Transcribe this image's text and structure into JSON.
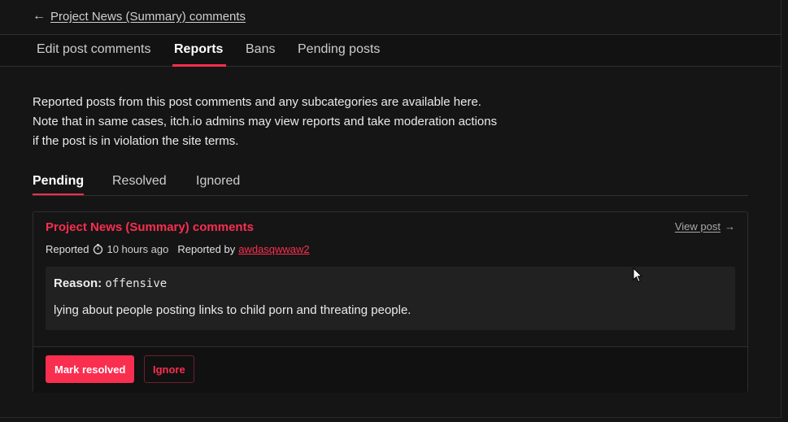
{
  "header": {
    "back_label": "Project News (Summary) comments"
  },
  "tabs": [
    {
      "label": "Edit post comments"
    },
    {
      "label": "Reports",
      "active": true
    },
    {
      "label": "Bans"
    },
    {
      "label": "Pending posts"
    }
  ],
  "description": {
    "line1": "Reported posts from this post comments and any subcategories are available here.",
    "line2": "Note that in same cases, itch.io admins may view reports and take moderation actions",
    "line3": "if the post is in violation the site terms."
  },
  "subtabs": [
    {
      "label": "Pending",
      "active": true
    },
    {
      "label": "Resolved"
    },
    {
      "label": "Ignored"
    }
  ],
  "report": {
    "title": "Project News (Summary) comments",
    "view_post": "View post",
    "reported_label": "Reported",
    "time": "10 hours ago",
    "reported_by_label": "Reported by",
    "reporter": "awdasqwwaw2",
    "reason_label": "Reason:",
    "reason_code": "offensive",
    "reason_text": "lying about people posting links to child porn and threating people.",
    "mark_resolved": "Mark resolved",
    "ignore": "Ignore"
  },
  "colors": {
    "accent": "#fa2e4f",
    "background": "#151515"
  },
  "icons": [
    "back-arrow-icon",
    "clock-icon",
    "arrow-right-icon",
    "mouse-cursor-icon"
  ]
}
